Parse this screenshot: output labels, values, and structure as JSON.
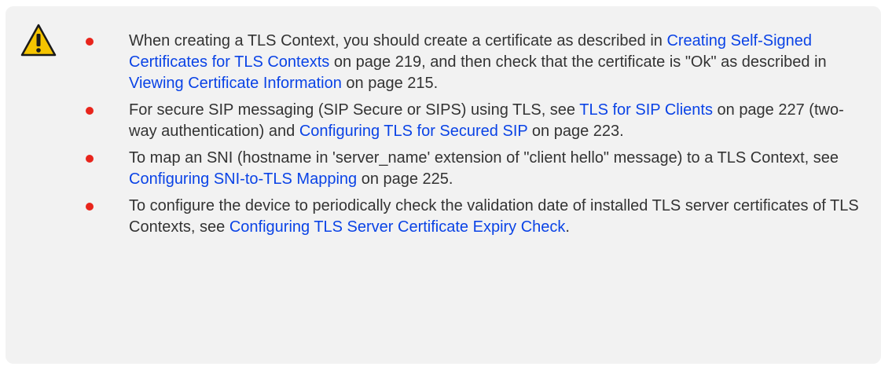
{
  "note": {
    "icon": "warning-icon",
    "bullet_color": "#e8251c",
    "link_color": "#0a43e6",
    "items": [
      {
        "t0": "When creating a TLS Context, you should create a certificate as described in ",
        "l0": "Creating Self-Signed Certificates for TLS Contexts",
        "t1": " on page 219, and then check that the certificate is \"Ok\" as described in ",
        "l1": "Viewing Certificate Information",
        "t2": " on page 215."
      },
      {
        "t0": "For secure SIP messaging (SIP Secure or SIPS) using TLS, see ",
        "l0": "TLS for SIP Clients",
        "t1": " on page 227 (two-way authentication) and ",
        "l1": "Configuring TLS for Secured SIP",
        "t2": " on page 223."
      },
      {
        "t0": "To map an SNI (hostname in 'server_name' extension of \"client hello\" message) to a TLS Context, see ",
        "l0": "Configuring SNI-to-TLS Mapping",
        "t1": " on page 225."
      },
      {
        "t0": "To configure the device to periodically check the validation date of installed TLS server certificates of TLS Contexts, see ",
        "l0": "Configuring TLS Server Certificate Expiry Check",
        "t1": "."
      }
    ]
  }
}
